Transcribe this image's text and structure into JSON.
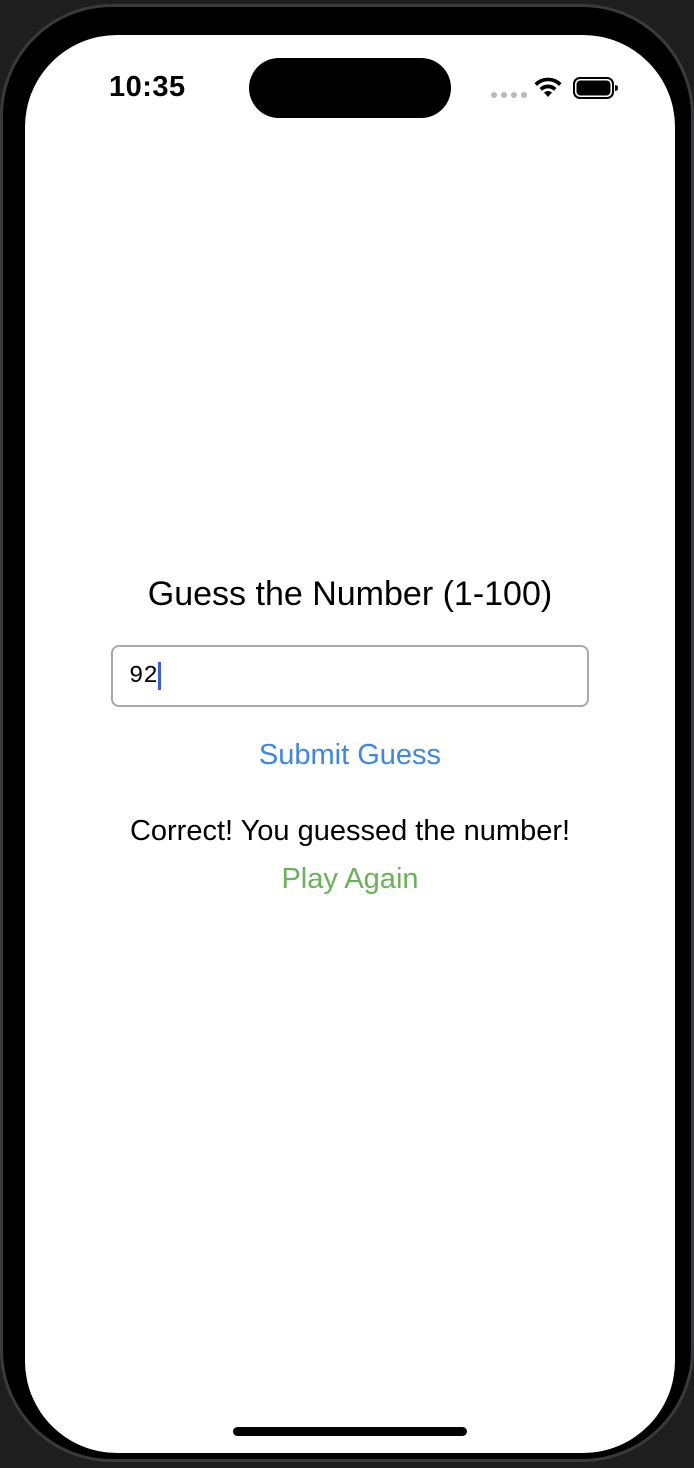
{
  "status_bar": {
    "time": "10:35",
    "wifi_icon": "wifi-icon",
    "battery_icon": "battery-icon"
  },
  "game": {
    "title": "Guess the Number (1-100)",
    "input_value": "92",
    "submit_label": "Submit Guess",
    "result_message": "Correct! You guessed the number!",
    "play_again_label": "Play Again"
  },
  "colors": {
    "submit": "#3d86e6",
    "play_again": "#6ab15a",
    "caret": "#3b5bdb"
  }
}
